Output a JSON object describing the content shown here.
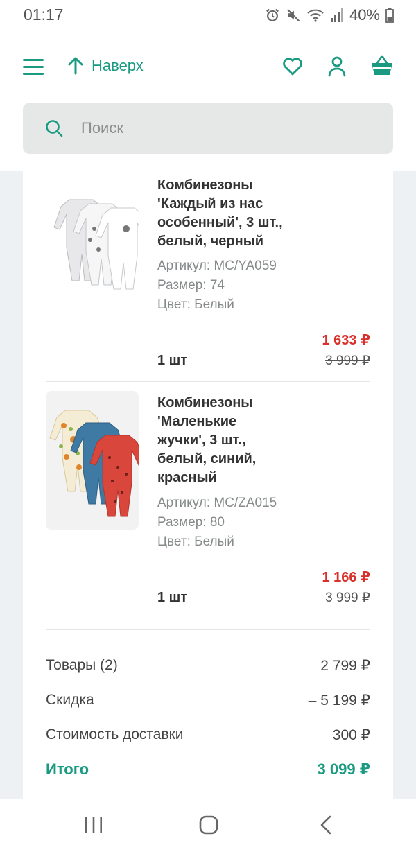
{
  "status_bar": {
    "time": "01:17",
    "battery": "40%"
  },
  "header": {
    "to_top_label": "Наверх",
    "search_placeholder": "Поиск"
  },
  "colors": {
    "accent": "#1a9a80",
    "sale_price": "#d9302c",
    "content_bg": "#eef1f4"
  },
  "cart": {
    "items": [
      {
        "title_lines": [
          "Комбинезоны",
          "'Каждый из нас",
          "особенный', 3 шт.,",
          "белый, черный"
        ],
        "article": "Артикул: MC/YA059",
        "size": "Размер: 74",
        "color": "Цвет: Белый",
        "quantity": "1 шт",
        "price": "1 633 ₽",
        "old_price": "3 999 ₽"
      },
      {
        "title_lines": [
          "Комбинезоны",
          "'Маленькие",
          "жучки', 3 шт.,",
          "белый, синий,",
          "красный"
        ],
        "article": "Артикул: MC/ZA015",
        "size": "Размер: 80",
        "color": "Цвет: Белый",
        "quantity": "1 шт",
        "price": "1 166 ₽",
        "old_price": "3 999 ₽"
      }
    ]
  },
  "summary": {
    "goods_label": "Товары (2)",
    "goods_value": "2 799 ₽",
    "discount_label": "Скидка",
    "discount_value": "– 5 199 ₽",
    "delivery_label": "Стоимость доставки",
    "delivery_value": "300 ₽",
    "total_label": "Итого",
    "total_value": "3 099 ₽"
  },
  "icons": {
    "menu": "hamburger-menu-icon",
    "to_top": "arrow-up-icon",
    "favorites": "heart-icon",
    "profile": "user-icon",
    "cart": "basket-icon",
    "search": "search-icon",
    "nav_recents": "recents-icon",
    "nav_home": "home-icon",
    "nav_back": "back-icon"
  }
}
